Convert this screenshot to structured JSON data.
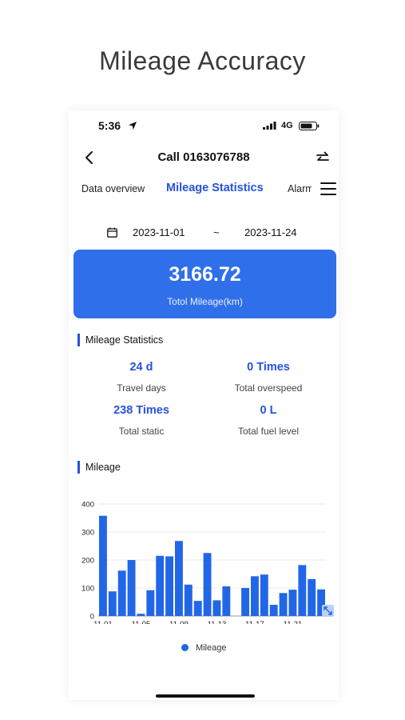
{
  "headline": "Mileage Accuracy",
  "status": {
    "time": "5:36",
    "network": "4G"
  },
  "nav": {
    "title": "Call 0163076788"
  },
  "tabs": [
    {
      "label": "Data overview"
    },
    {
      "label": "Mileage Statistics"
    },
    {
      "label": "Alarm"
    }
  ],
  "date_range": {
    "start": "2023-11-01",
    "separator": "~",
    "end": "2023-11-24"
  },
  "total": {
    "value": "3166.72",
    "label": "Totol Mileage(km)"
  },
  "stats_section": {
    "title": "Mileage Statistics"
  },
  "stats": [
    {
      "value": "24 d",
      "label": "Travel days"
    },
    {
      "value": "0 Times",
      "label": "Total overspeed"
    },
    {
      "value": "238 Times",
      "label": "Total static"
    },
    {
      "value": "0 L",
      "label": "Total fuel level"
    }
  ],
  "mileage_section": {
    "title": "Mileage"
  },
  "colors": {
    "accent": "#2752e0",
    "card": "#2f6fea",
    "bar": "#2266e8"
  },
  "icons": [
    "location-arrow-icon",
    "signal-icon",
    "battery-icon",
    "back-chevron-icon",
    "swap-icon",
    "menu-icon",
    "calendar-icon",
    "expand-icon"
  ],
  "chart_data": {
    "type": "bar",
    "categories": [
      "11-01",
      "11-02",
      "11-03",
      "11-04",
      "11-05",
      "11-06",
      "11-07",
      "11-08",
      "11-09",
      "11-10",
      "11-11",
      "11-12",
      "11-13",
      "11-14",
      "11-15",
      "11-16",
      "11-17",
      "11-18",
      "11-19",
      "11-20",
      "11-21",
      "11-22",
      "11-23",
      "11-24"
    ],
    "tick_labels": [
      "11-01",
      "11-05",
      "11-09",
      "11-13",
      "11-17",
      "11-21"
    ],
    "series": [
      {
        "name": "Mileage",
        "values": [
          358,
          88,
          162,
          200,
          8,
          92,
          215,
          213,
          268,
          112,
          54,
          225,
          56,
          106,
          0,
          100,
          142,
          148,
          40,
          82,
          94,
          182,
          132,
          95
        ]
      }
    ],
    "ylim": [
      0,
      400
    ],
    "yticks": [
      0,
      100,
      200,
      300,
      400
    ],
    "grid": true,
    "legend": "bottom"
  }
}
